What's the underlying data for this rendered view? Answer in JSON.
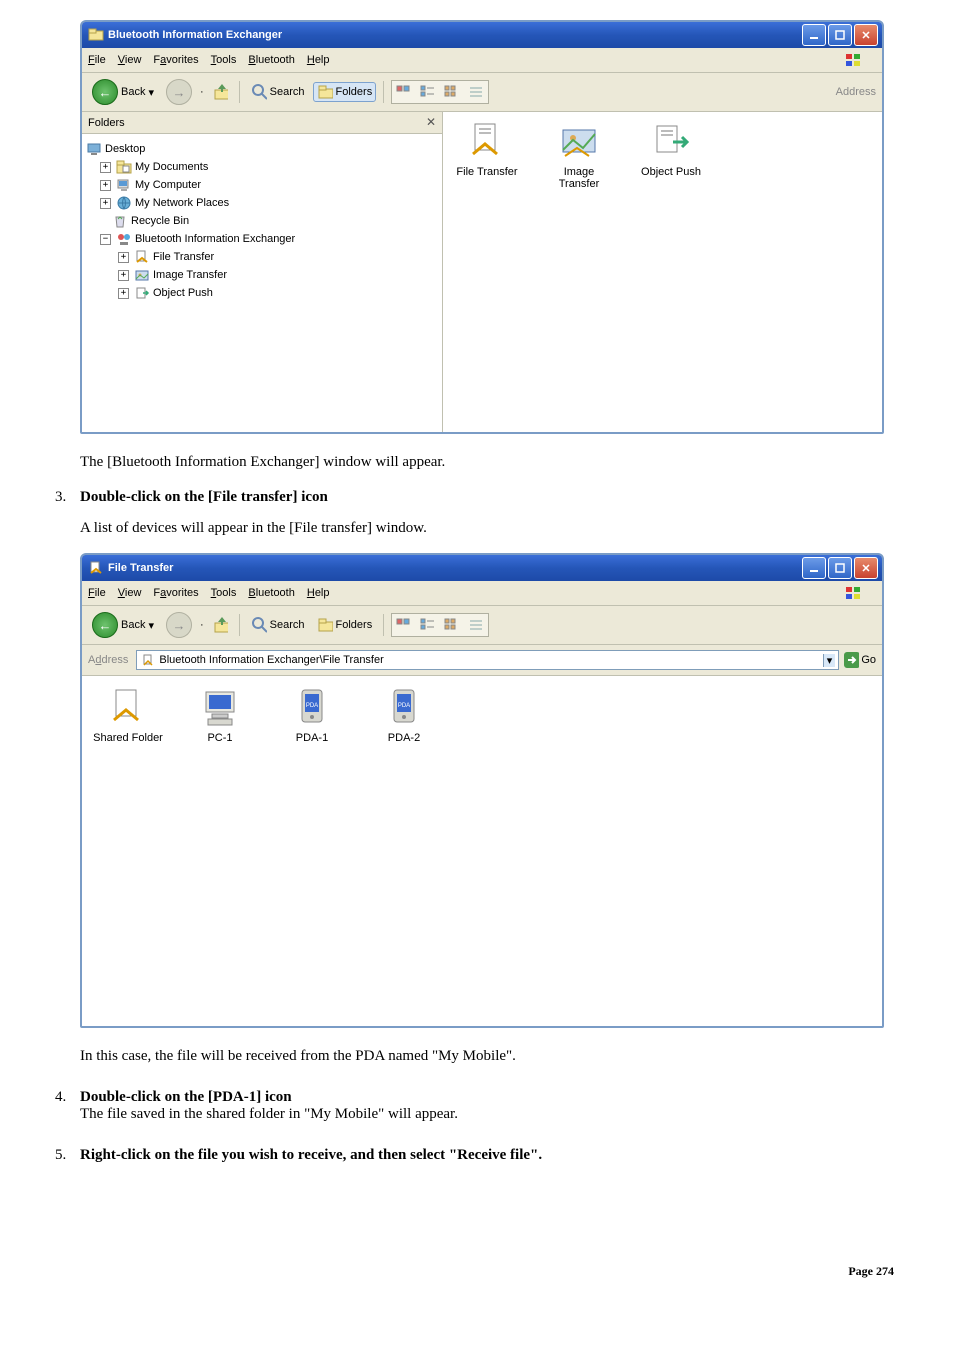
{
  "win1": {
    "title": "Bluetooth Information Exchanger",
    "menu": {
      "file": "File",
      "view": "View",
      "favorites": "Favorites",
      "tools": "Tools",
      "bluetooth": "Bluetooth",
      "help": "Help"
    },
    "toolbar": {
      "back": "Back",
      "search": "Search",
      "folders": "Folders",
      "address": "Address"
    },
    "folders_header": "Folders",
    "tree": {
      "desktop": "Desktop",
      "mydocs": "My Documents",
      "mycomp": "My Computer",
      "mynet": "My Network Places",
      "recycle": "Recycle Bin",
      "bie": "Bluetooth Information Exchanger",
      "ft": "File Transfer",
      "it": "Image Transfer",
      "op": "Object Push"
    },
    "icons": {
      "ft": "File Transfer",
      "it": "Image Transfer",
      "op": "Object Push"
    }
  },
  "caption1": "The [Bluetooth Information Exchanger] window will appear.",
  "step3": {
    "title": "Double-click on the [File transfer] icon",
    "sub": "A list of devices will appear in the [File transfer] window."
  },
  "win2": {
    "title": "File Transfer",
    "menu": {
      "file": "File",
      "view": "View",
      "favorites": "Favorites",
      "tools": "Tools",
      "bluetooth": "Bluetooth",
      "help": "Help"
    },
    "toolbar": {
      "back": "Back",
      "search": "Search",
      "folders": "Folders"
    },
    "address_label": "Address",
    "address_value": "Bluetooth Information Exchanger\\File Transfer",
    "go": "Go",
    "icons": {
      "sf": "Shared Folder",
      "pc1": "PC-1",
      "pda1": "PDA-1",
      "pda2": "PDA-2"
    }
  },
  "caption2": "In this case, the file will be received from the PDA named \"My Mobile\".",
  "step4": {
    "title": "Double-click on the [PDA-1] icon",
    "sub": "The file saved in the shared folder in \"My Mobile\" will appear."
  },
  "step5": {
    "title": "Right-click on the file you wish to receive, and then select \"Receive file\"."
  },
  "page": "Page 274"
}
